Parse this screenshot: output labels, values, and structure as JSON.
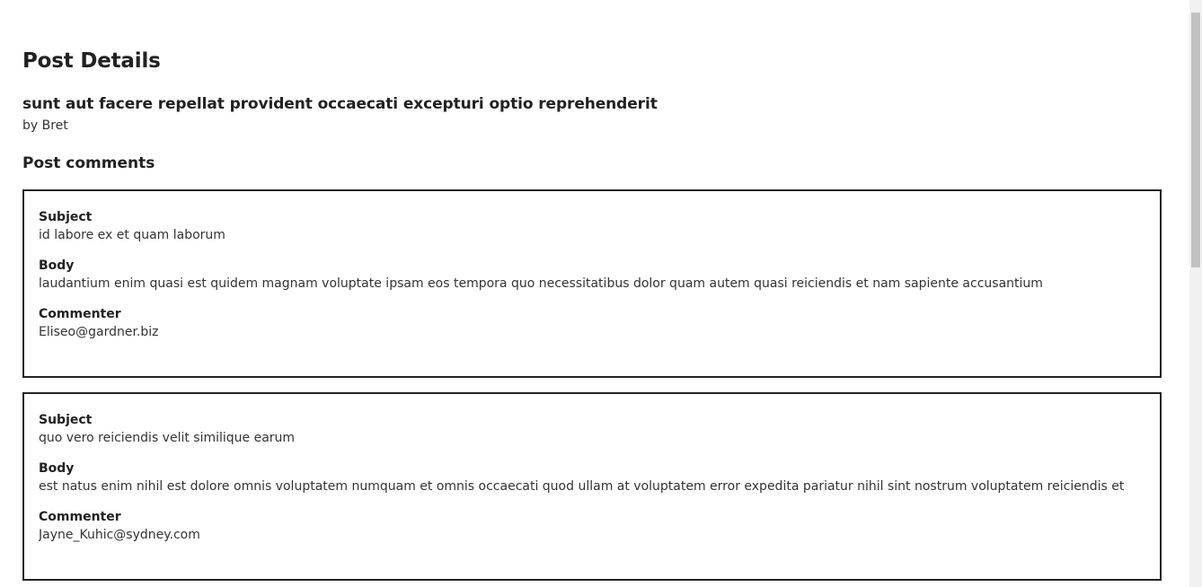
{
  "page": {
    "title": "Post Details"
  },
  "post": {
    "title": "sunt aut facere repellat provident occaecati excepturi optio reprehenderit",
    "author": "by Bret"
  },
  "comments_section": {
    "heading": "Post comments",
    "subject_label": "Subject",
    "body_label": "Body",
    "commenter_label": "Commenter"
  },
  "comments": [
    {
      "subject": "id labore ex et quam laborum",
      "body": "laudantium enim quasi est quidem magnam voluptate ipsam eos tempora quo necessitatibus dolor quam autem quasi reiciendis et nam sapiente accusantium",
      "commenter": "Eliseo@gardner.biz"
    },
    {
      "subject": "quo vero reiciendis velit similique earum",
      "body": "est natus enim nihil est dolore omnis voluptatem numquam et omnis occaecati quod ullam at voluptatem error expedita pariatur nihil sint nostrum voluptatem reiciendis et",
      "commenter": "Jayne_Kuhic@sydney.com"
    }
  ]
}
